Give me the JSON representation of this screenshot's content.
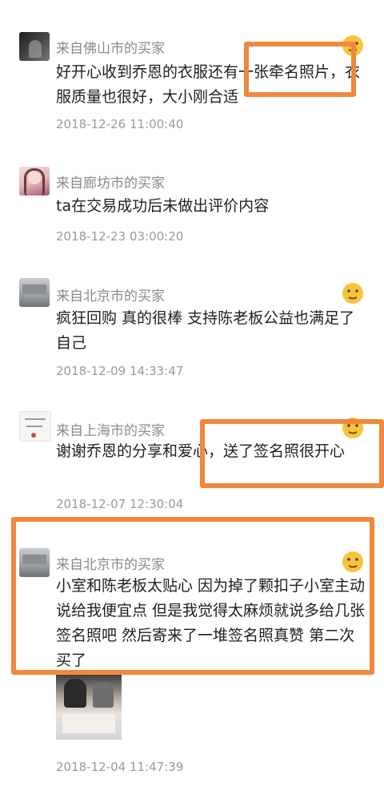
{
  "reviews": [
    {
      "buyer": "来自佛山市的买家",
      "text": "好开心收到乔恩的衣服还有一张牵名照片，衣服质量也很好，大小刚合适",
      "date": "2018-12-26 11:00:40",
      "has_emoji": true
    },
    {
      "buyer": "来自廊坊市的买家",
      "text": "ta在交易成功后未做出评价内容",
      "date": "2018-12-23 03:00:20",
      "has_emoji": false
    },
    {
      "buyer": "来自北京市的买家",
      "text": "疯狂回购 真的很棒 支持陈老板公益也满足了自己",
      "date": "2018-12-09 14:33:47",
      "has_emoji": true
    },
    {
      "buyer": "来自上海市的买家",
      "text": "谢谢乔恩的分享和爱心，送了签名照很开心",
      "date": "2018-12-07 12:30:04",
      "has_emoji": true
    },
    {
      "buyer": "来自北京市的买家",
      "text": "小室和陈老板太贴心 因为掉了颗扣子小室主动说给我便宜点 但是我觉得太麻烦就说多给几张签名照吧 然后寄来了一堆签名照真赞 第二次买了",
      "date": "2018-12-04 11:47:39",
      "has_emoji": true,
      "has_photo": true
    }
  ],
  "colors": {
    "highlight": "#f0883c",
    "emoji_face": "#f7c53b"
  }
}
